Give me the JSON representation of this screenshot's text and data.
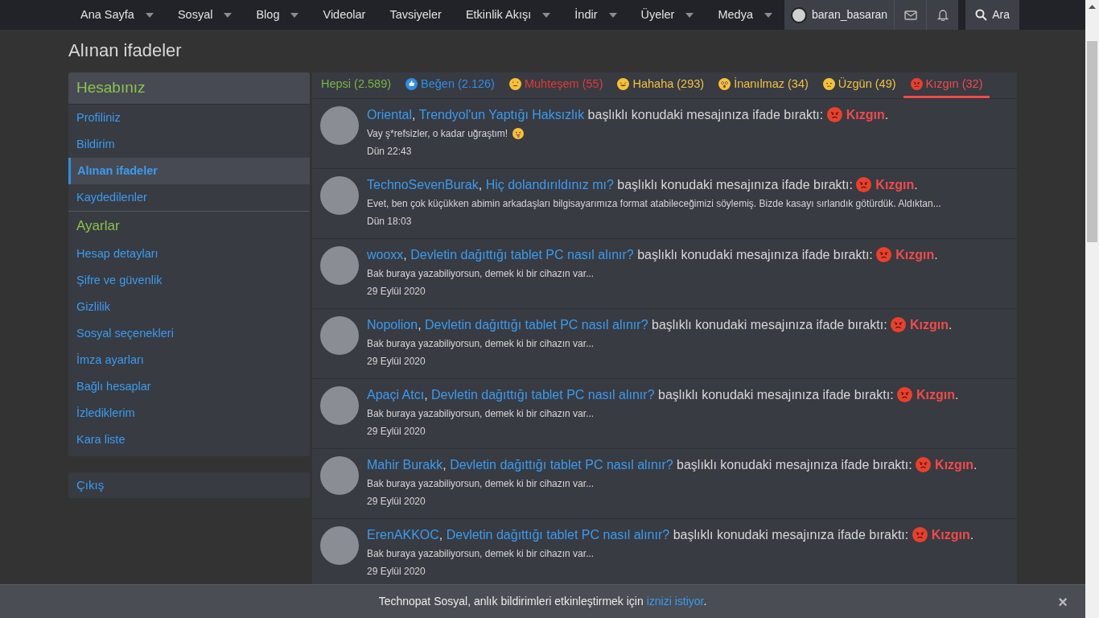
{
  "nav": {
    "items": [
      {
        "label": "Ana Sayfa",
        "has_menu": true
      },
      {
        "label": "Sosyal",
        "has_menu": true
      },
      {
        "label": "Blog",
        "has_menu": true
      },
      {
        "label": "Videolar",
        "has_menu": false
      },
      {
        "label": "Tavsiyeler",
        "has_menu": false
      },
      {
        "label": "Etkinlik Akışı",
        "has_menu": true
      },
      {
        "label": "İndir",
        "has_menu": true
      },
      {
        "label": "Üyeler",
        "has_menu": true
      },
      {
        "label": "Medya",
        "has_menu": true
      }
    ],
    "user": "baran_basaran",
    "search": "Ara"
  },
  "page_title": "Alınan ifadeler",
  "sidebar": {
    "sections": [
      {
        "title": "Hesabınız",
        "items": [
          {
            "label": "Profiliniz",
            "selected": false
          },
          {
            "label": "Bildirim",
            "selected": false
          },
          {
            "label": "Alınan ifadeler",
            "selected": true
          },
          {
            "label": "Kaydedilenler",
            "selected": false
          }
        ]
      },
      {
        "title": "Ayarlar",
        "items": [
          {
            "label": "Hesap detayları",
            "selected": false
          },
          {
            "label": "Şifre ve güvenlik",
            "selected": false
          },
          {
            "label": "Gizlilik",
            "selected": false
          },
          {
            "label": "Sosyal seçenekleri",
            "selected": false
          },
          {
            "label": "İmza ayarları",
            "selected": false
          },
          {
            "label": "Bağlı hesaplar",
            "selected": false
          },
          {
            "label": "İzlediklerim",
            "selected": false
          },
          {
            "label": "Kara liste",
            "selected": false
          }
        ]
      }
    ],
    "logout": "Çıkış"
  },
  "tabs": [
    {
      "label": "Hepsi (2.589)",
      "kind": "all",
      "color": "#7cb342",
      "selected": false
    },
    {
      "label": "Beğen (2.126)",
      "kind": "like",
      "color": "#2f8ee6",
      "selected": false
    },
    {
      "label": "Muhteşem (55)",
      "kind": "love",
      "color": "#e53935",
      "selected": false
    },
    {
      "label": "Hahaha (293)",
      "kind": "haha",
      "color": "#f2c13c",
      "selected": false
    },
    {
      "label": "İnanılmaz (34)",
      "kind": "wow",
      "color": "#f2c13c",
      "selected": false
    },
    {
      "label": "Üzgün (49)",
      "kind": "sad",
      "color": "#f2c13c",
      "selected": false
    },
    {
      "label": "Kızgın (32)",
      "kind": "angry",
      "color": "#f24a4a",
      "selected": true
    }
  ],
  "alerts": [
    {
      "user": "Oriental",
      "sep": ",",
      "thread": "Trendyol'un Yaptığı Haksızlık",
      "text": "başlıklı konudaki mesajınıza ifade bıraktı:",
      "reaction": "Kızgın",
      "end": ".",
      "snippet": "Vay ş*refsizler, o kadar uğraştım!",
      "snippet_emoji": true,
      "time": "Dün 22:43"
    },
    {
      "user": "TechnoSevenBurak",
      "sep": ",",
      "thread": "Hiç dolandırıldınız mı?",
      "text": "başlıklı konudaki mesajınıza ifade bıraktı:",
      "reaction": "Kızgın",
      "end": ".",
      "snippet": "Evet, ben çok küçükken abimin arkadaşları bilgisayarımıza format atabileceğimizi söylemiş. Bizde kasayı sırlandık götürdük. Aldıktan...",
      "time": "Dün 18:03"
    },
    {
      "user": "wooxx",
      "sep": ",",
      "thread": "Devletin dağıttığı tablet PC nasıl alınır?",
      "text": "başlıklı konudaki mesajınıza ifade bıraktı:",
      "reaction": "Kızgın",
      "end": ".",
      "snippet": "Bak buraya yazabiliyorsun, demek ki bir cihazın var...",
      "time": "29 Eylül 2020"
    },
    {
      "user": "Nopolion",
      "sep": ",",
      "thread": "Devletin dağıttığı tablet PC nasıl alınır?",
      "text": "başlıklı konudaki mesajınıza ifade bıraktı:",
      "reaction": "Kızgın",
      "end": ".",
      "snippet": "Bak buraya yazabiliyorsun, demek ki bir cihazın var...",
      "time": "29 Eylül 2020"
    },
    {
      "user": "Apaçi Atcı",
      "sep": ",",
      "thread": "Devletin dağıttığı tablet PC nasıl alınır?",
      "text": "başlıklı konudaki mesajınıza ifade bıraktı:",
      "reaction": "Kızgın",
      "end": ".",
      "snippet": "Bak buraya yazabiliyorsun, demek ki bir cihazın var...",
      "time": "29 Eylül 2020"
    },
    {
      "user": "Mahir Burakk",
      "sep": ",",
      "thread": "Devletin dağıttığı tablet PC nasıl alınır?",
      "text": "başlıklı konudaki mesajınıza ifade bıraktı:",
      "reaction": "Kızgın",
      "end": ".",
      "snippet": "Bak buraya yazabiliyorsun, demek ki bir cihazın var...",
      "time": "29 Eylül 2020"
    },
    {
      "user": "ErenAKKOC",
      "sep": ",",
      "thread": "Devletin dağıttığı tablet PC nasıl alınır?",
      "text": "başlıklı konudaki mesajınıza ifade bıraktı:",
      "reaction": "Kızgın",
      "end": ".",
      "snippet": "Bak buraya yazabiliyorsun, demek ki bir cihazın var...",
      "time": "29 Eylül 2020"
    }
  ],
  "banner": {
    "text": "Technopat Sosyal, anlık bildirimleri etkinleştirmek için",
    "link": "iznizi istiyor",
    "end": ".",
    "close": "×"
  }
}
